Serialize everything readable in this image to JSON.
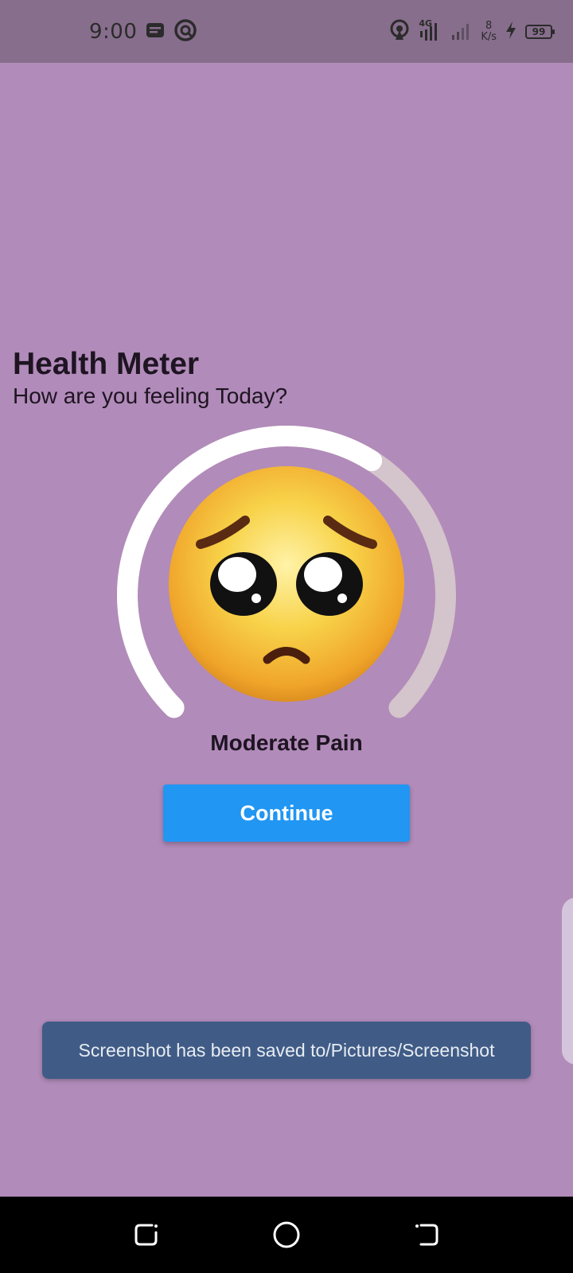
{
  "status_bar": {
    "time": "9:00",
    "network_type": "4G",
    "speed_value": "8",
    "speed_unit": "K/s",
    "battery_level": "99",
    "icons": [
      "message-notification-icon",
      "app-notification-icon",
      "hotspot-icon",
      "signal-4g-icon",
      "signal-icon",
      "charging-icon",
      "battery-icon"
    ]
  },
  "main": {
    "title": "Health Meter",
    "subtitle": "How are you feeling Today?",
    "gauge": {
      "level_fraction": 0.62,
      "track_color": "#d4c4cb",
      "fill_color": "#ffffff"
    },
    "emoji": "pleading-face",
    "pain_label": "Moderate Pain",
    "continue_label": "Continue",
    "accent_color": "#2196f3"
  },
  "toast": {
    "message": "Screenshot has been saved to/Pictures/Screenshot"
  },
  "nav": {
    "icons": [
      "recent-apps-icon",
      "home-icon",
      "back-icon"
    ]
  }
}
